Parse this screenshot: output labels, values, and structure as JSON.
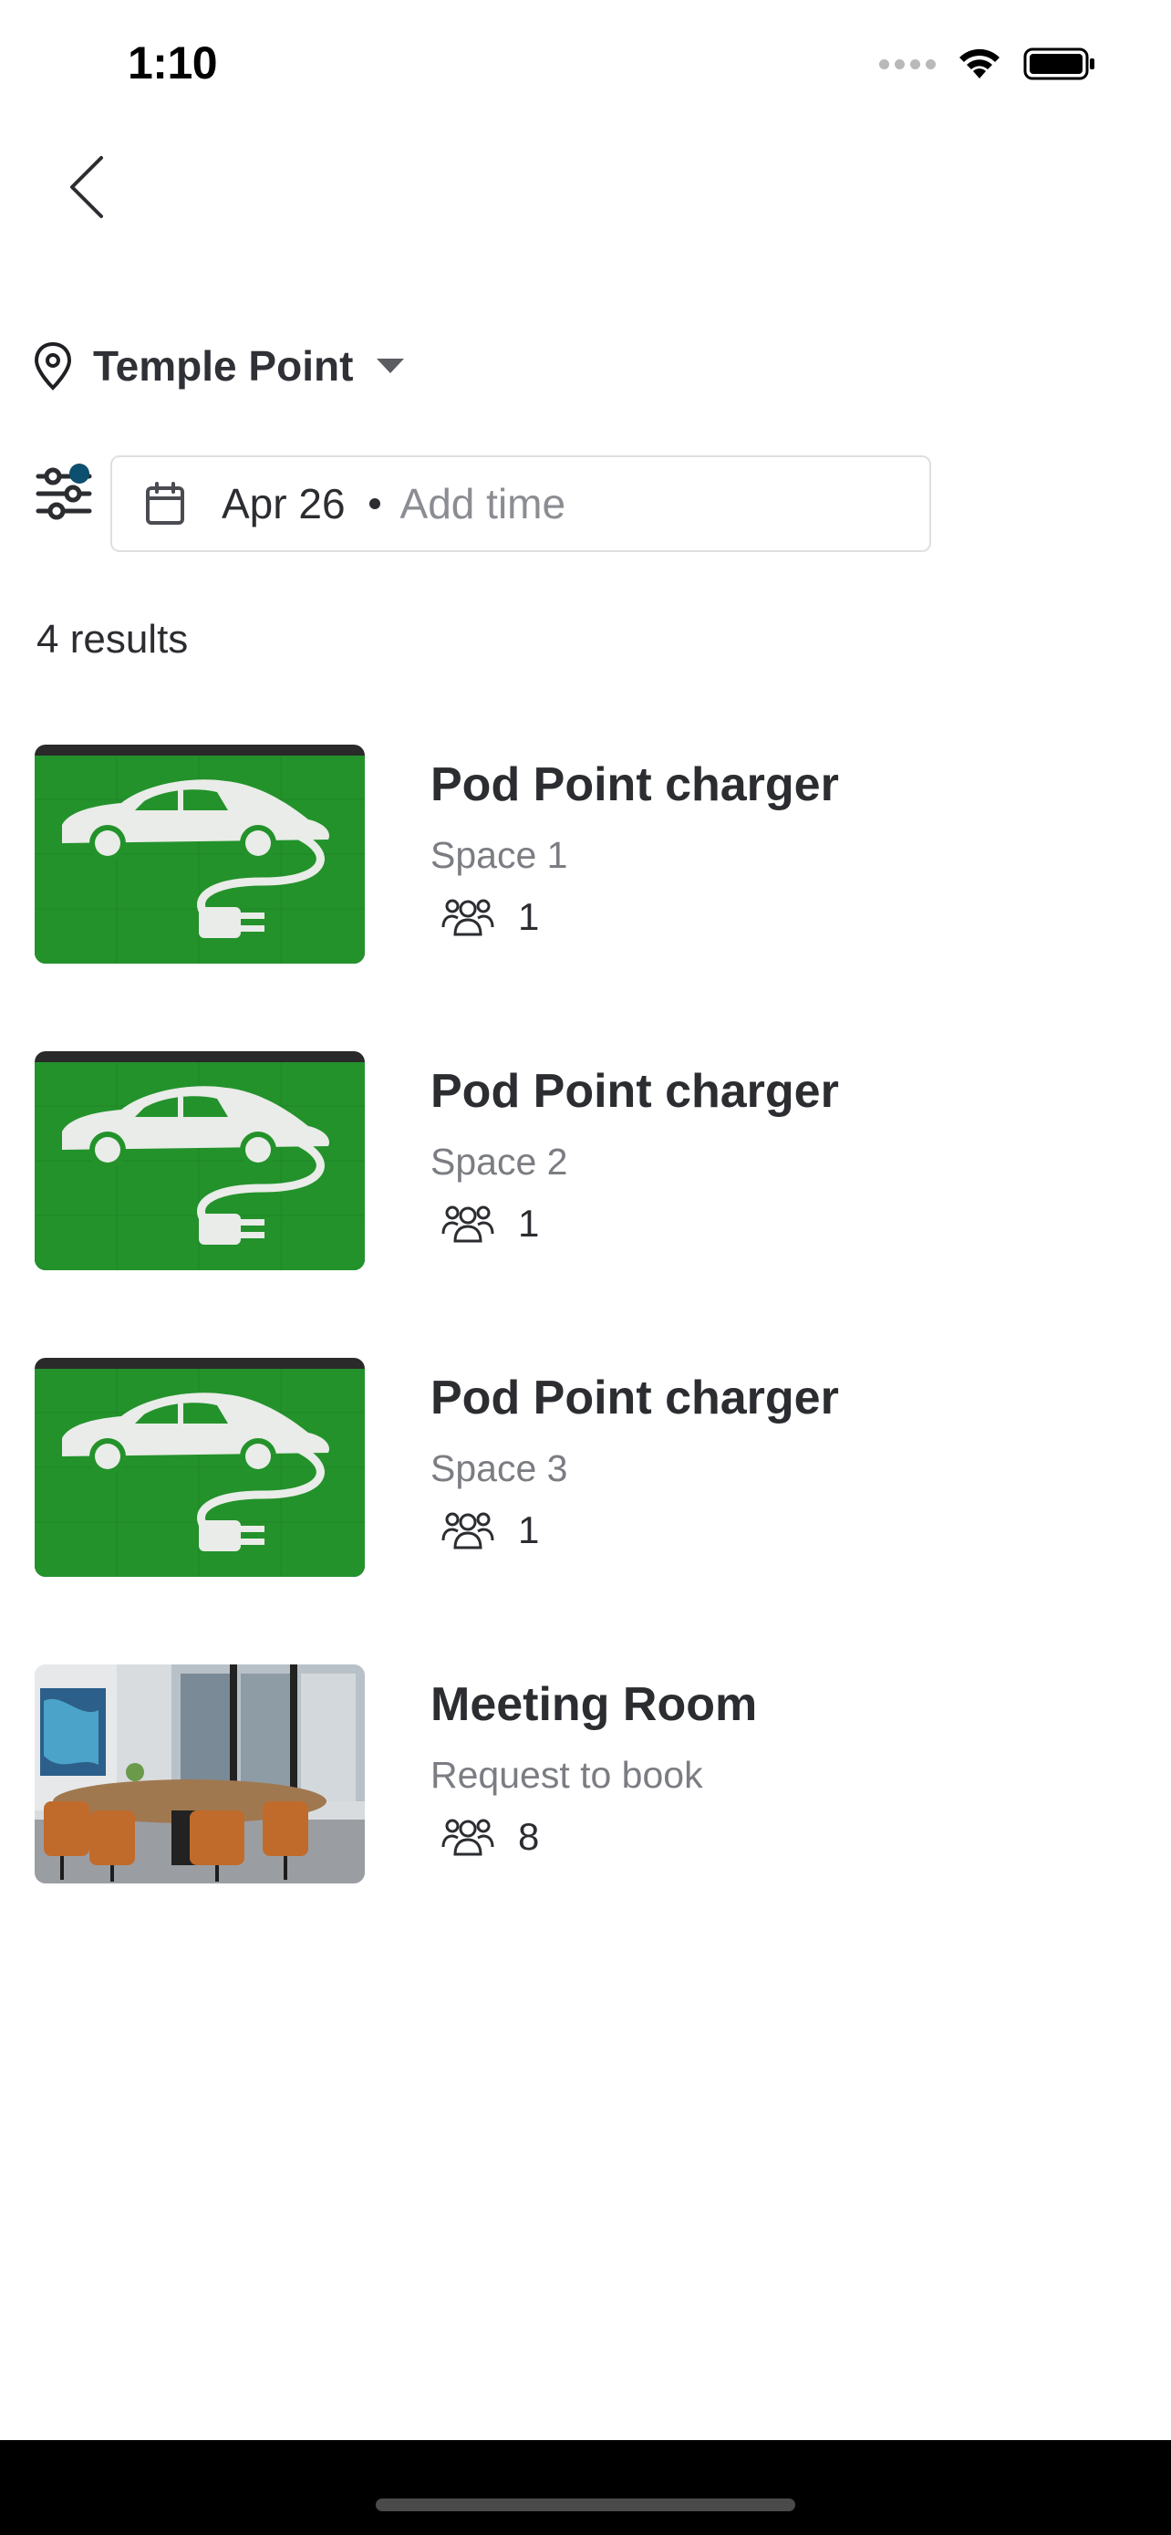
{
  "status_bar": {
    "time": "1:10",
    "icons": [
      "signal-dots-icon",
      "wifi-icon",
      "battery-icon"
    ]
  },
  "nav": {
    "back_icon": "chevron-left-icon"
  },
  "location": {
    "name": "Temple Point",
    "icon": "map-pin-icon",
    "dropdown_icon": "caret-down-icon"
  },
  "search": {
    "filter_icon": "sliders-icon",
    "filter_active": true,
    "date": "Apr 26",
    "time_placeholder": "Add time"
  },
  "results": {
    "count_label": "4 results",
    "items": [
      {
        "title": "Pod Point charger",
        "subtitle": "Space 1",
        "capacity": "1",
        "image": "ev-charger-parking-image"
      },
      {
        "title": "Pod Point charger",
        "subtitle": "Space 2",
        "capacity": "1",
        "image": "ev-charger-parking-image"
      },
      {
        "title": "Pod Point charger",
        "subtitle": "Space 3",
        "capacity": "1",
        "image": "ev-charger-parking-image"
      },
      {
        "title": "Meeting Room",
        "subtitle": "Request to book",
        "capacity": "8",
        "image": "meeting-room-image"
      }
    ]
  },
  "colors": {
    "accent_dot": "#0d4f6e",
    "text_primary": "#2b2d31",
    "text_secondary": "#7b7d83",
    "ev_green": "#1f9a2a"
  }
}
